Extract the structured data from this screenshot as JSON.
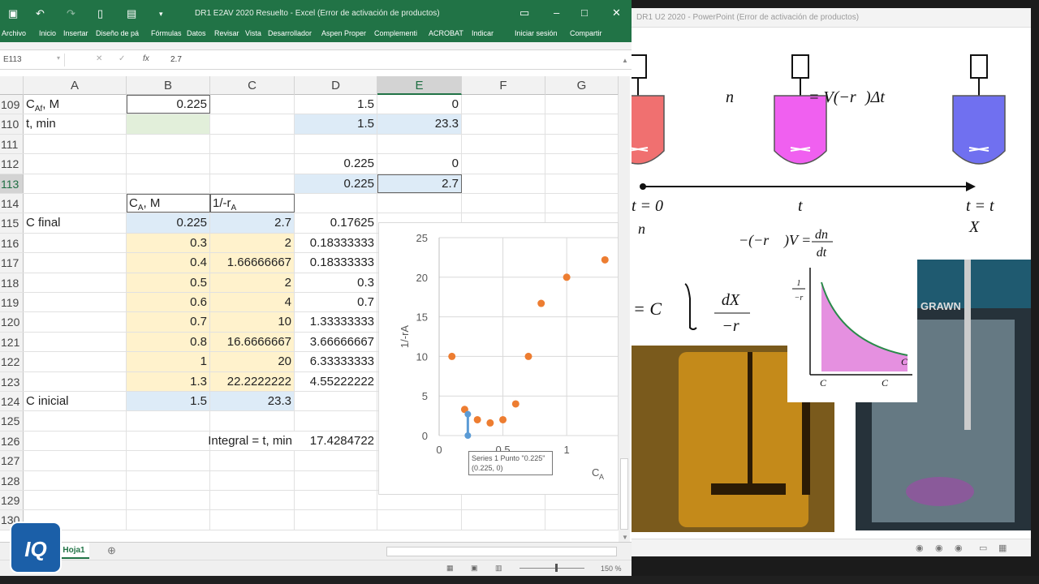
{
  "excel": {
    "window_title": "DR1 E2AV 2020 Resuelto - Excel (Error de activación de productos)",
    "ribbon_tabs": [
      "Archivo",
      "Inicio",
      "Insertar",
      "Diseño de pá",
      "Fórmulas",
      "Datos",
      "Revisar",
      "Vista",
      "Desarrollador",
      "Aspen Proper",
      "Complementi",
      "ACROBAT",
      "Indicar",
      "Iniciar sesión",
      "Compartir"
    ],
    "name_box": "E113",
    "formula_value": "2.7",
    "columns": [
      "A",
      "B",
      "C",
      "D",
      "E",
      "F",
      "G"
    ],
    "selected_column": "E",
    "selected_row": "113",
    "rows": [
      {
        "num": "109",
        "a": "C",
        "a_sub": "Af",
        "a_rest": ", M",
        "b": "0.225",
        "c": "",
        "d": "1.5",
        "e": "0"
      },
      {
        "num": "110",
        "a": "t, min",
        "b": "",
        "c": "",
        "d": "1.5",
        "e": "23.3"
      },
      {
        "num": "111",
        "a": "",
        "b": "",
        "c": "",
        "d": "",
        "e": ""
      },
      {
        "num": "112",
        "a": "",
        "b": "",
        "c": "",
        "d": "0.225",
        "e": "0"
      },
      {
        "num": "113",
        "a": "",
        "b": "",
        "c": "",
        "d": "0.225",
        "e": "2.7"
      },
      {
        "num": "114",
        "a": "",
        "b": "C",
        "b_sub": "A",
        "b_rest": ", M",
        "c": "1/-r",
        "c_sub": "A",
        "d": "",
        "e": ""
      },
      {
        "num": "115",
        "a": "C final",
        "b": "0.225",
        "c": "2.7",
        "d": "0.17625",
        "e": ""
      },
      {
        "num": "116",
        "a": "",
        "b": "0.3",
        "c": "2",
        "d": "0.18333333",
        "e": ""
      },
      {
        "num": "117",
        "a": "",
        "b": "0.4",
        "c": "1.66666667",
        "d": "0.18333333",
        "e": ""
      },
      {
        "num": "118",
        "a": "",
        "b": "0.5",
        "c": "2",
        "d": "0.3",
        "e": ""
      },
      {
        "num": "119",
        "a": "",
        "b": "0.6",
        "c": "4",
        "d": "0.7",
        "e": ""
      },
      {
        "num": "120",
        "a": "",
        "b": "0.7",
        "c": "10",
        "d": "1.33333333",
        "e": ""
      },
      {
        "num": "121",
        "a": "",
        "b": "0.8",
        "c": "16.6666667",
        "d": "3.66666667",
        "e": ""
      },
      {
        "num": "122",
        "a": "",
        "b": "1",
        "c": "20",
        "d": "6.33333333",
        "e": ""
      },
      {
        "num": "123",
        "a": "",
        "b": "1.3",
        "c": "22.2222222",
        "d": "4.55222222",
        "e": ""
      },
      {
        "num": "124",
        "a": "C inicial",
        "b": "1.5",
        "c": "23.3",
        "d": "",
        "e": ""
      },
      {
        "num": "125",
        "a": "",
        "b": "",
        "c": "",
        "d": "",
        "e": ""
      },
      {
        "num": "126",
        "a": "",
        "b": "",
        "c": "Integral = t, min",
        "d": "17.4284722",
        "e": ""
      },
      {
        "num": "127",
        "a": "",
        "b": "",
        "c": "",
        "d": "",
        "e": ""
      },
      {
        "num": "128",
        "a": "",
        "b": "",
        "c": "",
        "d": "",
        "e": ""
      },
      {
        "num": "129",
        "a": "",
        "b": "",
        "c": "",
        "d": "",
        "e": ""
      },
      {
        "num": "130",
        "a": "",
        "b": "",
        "c": "",
        "d": "",
        "e": ""
      }
    ],
    "sheet_tab": "Hoja1",
    "zoom": "150 %",
    "tooltip_line1": "Series 1 Punto \"0.225\"",
    "tooltip_line2": "(0.225, 0)"
  },
  "chart_data": {
    "type": "scatter",
    "ylabel": "1/-rA",
    "xlabel": "C",
    "xlabel_sub": "A",
    "xlim": [
      0,
      1.4
    ],
    "ylim": [
      0,
      25
    ],
    "y_ticks": [
      "0",
      "5",
      "10",
      "15",
      "20",
      "25"
    ],
    "x_ticks": [
      "0",
      "0.5",
      "1"
    ],
    "series": [
      {
        "name": "Series 1",
        "color": "#ed7d31",
        "x": [
          0.1,
          0.2,
          0.3,
          0.4,
          0.5,
          0.6,
          0.7,
          0.8,
          1.0,
          1.3
        ],
        "y": [
          10,
          3.3,
          2,
          1.6,
          2,
          4,
          10,
          16.7,
          20,
          22.2
        ]
      }
    ],
    "selected_segment": {
      "color": "#5b9bd5",
      "x": [
        0.225,
        0.225
      ],
      "y": [
        0,
        2.7
      ]
    }
  },
  "ppt": {
    "window_title": "DR1 U2 2020 - PowerPoint (Error de activación de productos)",
    "balance_eq_lhs": "n",
    "balance_eq_rhs": "= V(−r",
    "balance_eq_end": ")Δt",
    "t0": "t = 0",
    "t_mid": "t",
    "tf": "t = t",
    "nA0": "n",
    "XAf": "X",
    "diff_eq": "−(−r",
    "diff_eq_2": ")V =",
    "diff_num": "dn",
    "diff_den": "dt",
    "integral_lhs": "= C",
    "integral_num": "dX",
    "integral_den": "−r",
    "graph_ylabel": "1",
    "graph_ylabel_den": "−r",
    "graph_xlabel": "C",
    "graph_x1": "C",
    "graph_x2": "C",
    "photo_label": "GRAWN",
    "colors": {
      "tank1": "#f07070",
      "tank2": "#f060f0",
      "tank3": "#7070f0"
    }
  }
}
